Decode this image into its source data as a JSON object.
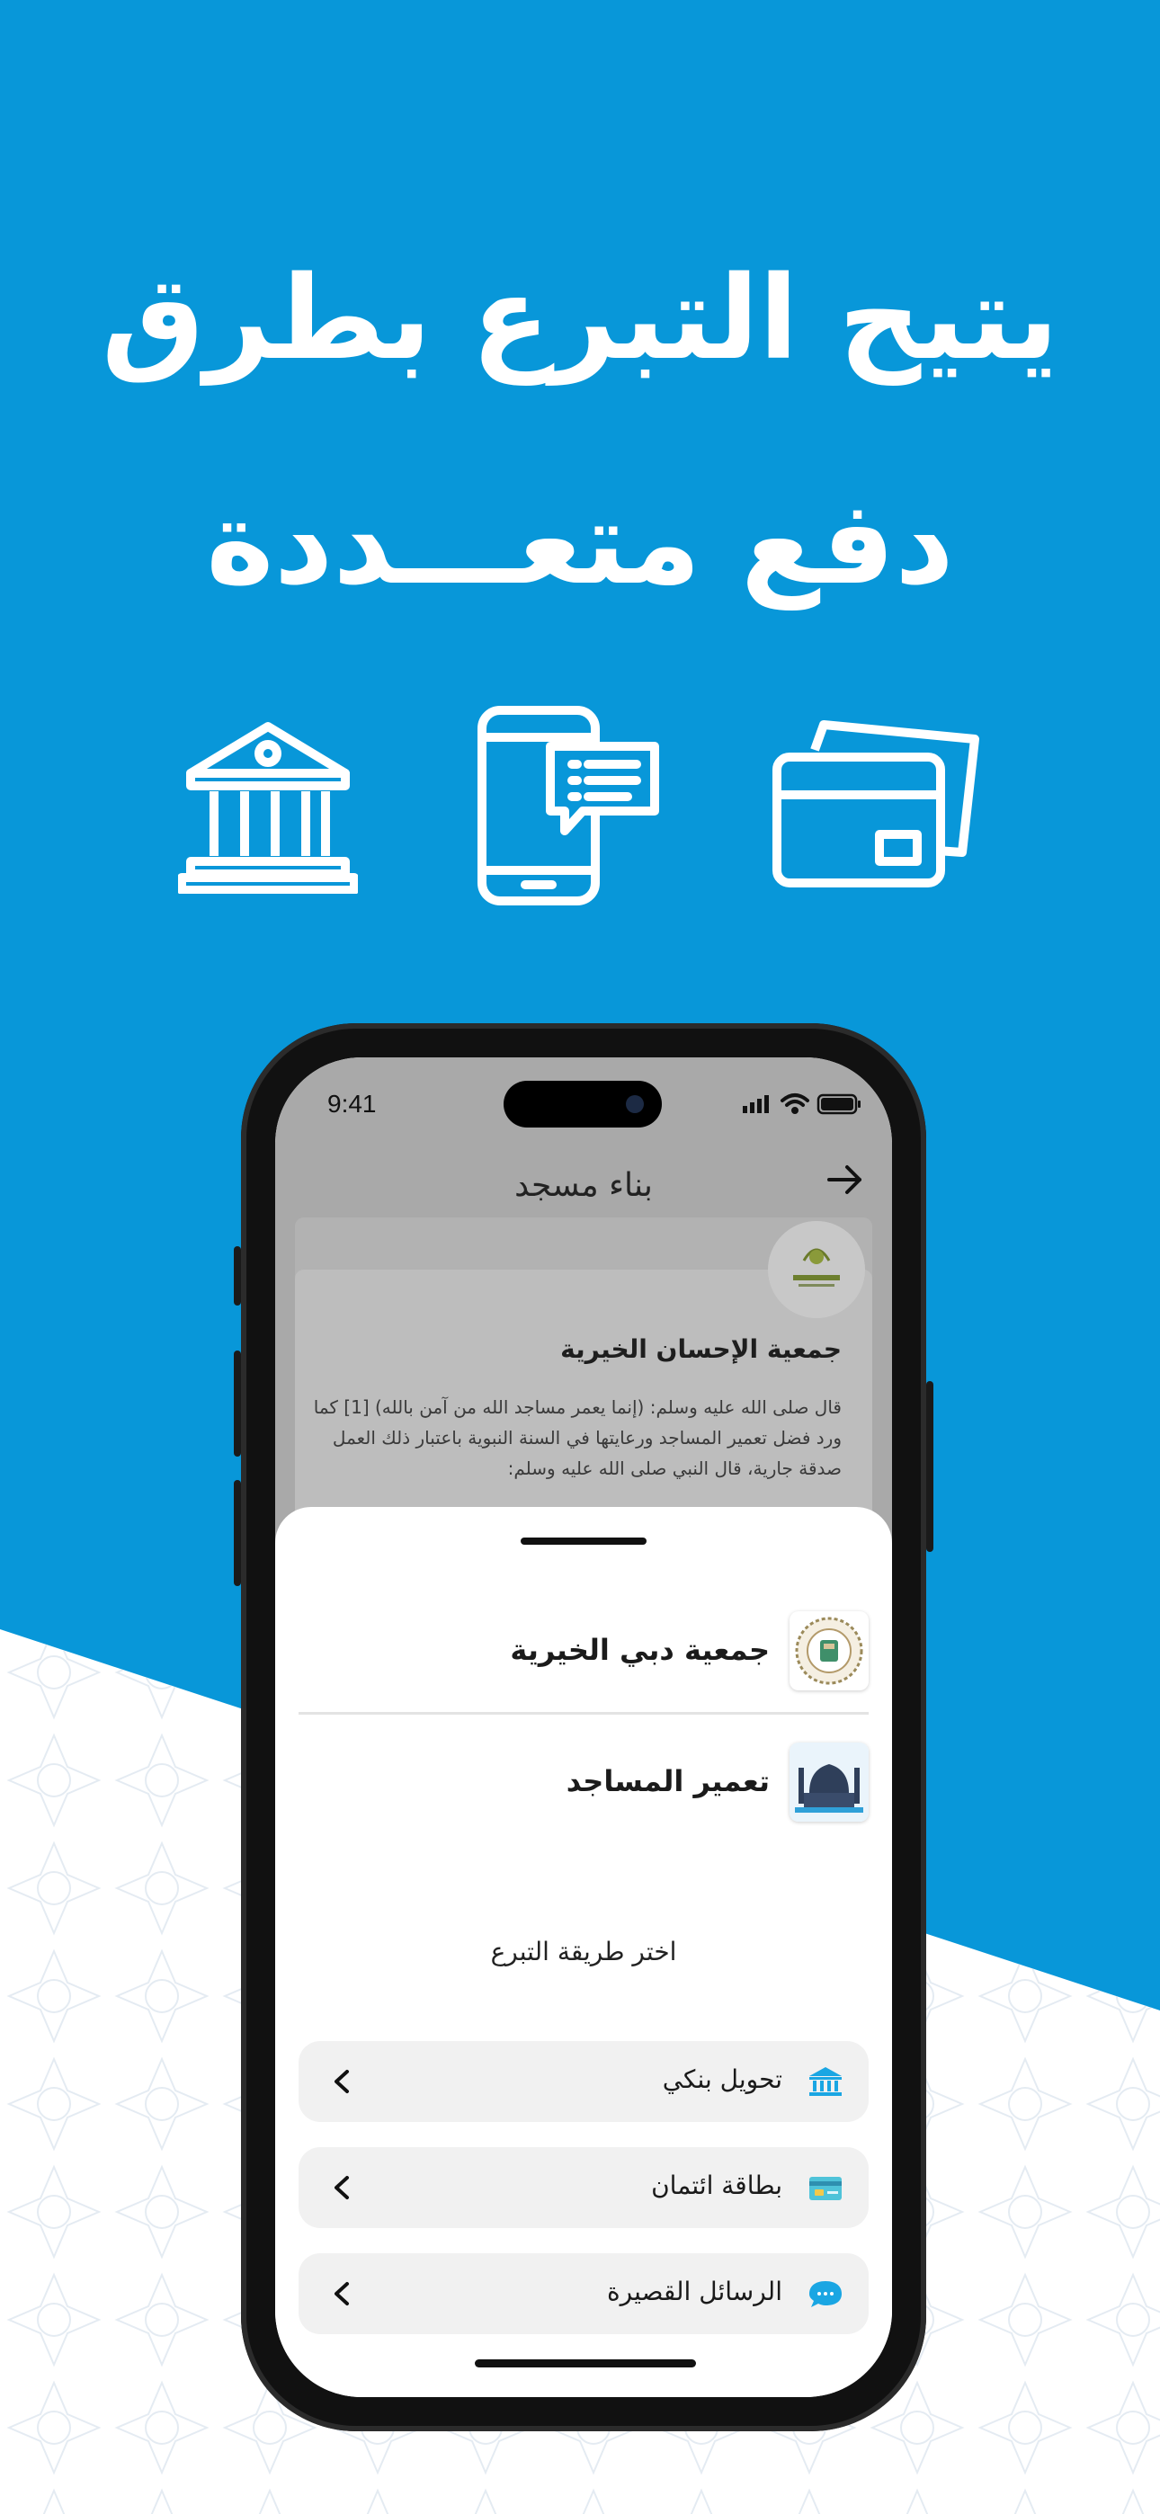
{
  "promo": {
    "headline_line1": "يتيح التبرع بطرق",
    "headline_line2": "دفع متعـــددة",
    "feature_icons": [
      "bank-icon",
      "sms-phone-icon",
      "credit-card-icon"
    ]
  },
  "colors": {
    "background_blue": "#0897d9",
    "accent": "#1aa6e3",
    "white": "#ffffff"
  },
  "status_bar": {
    "time": "9:41"
  },
  "screen": {
    "nav_title": "بناء مسجد",
    "org_name": "جمعية الإحسان الخيرية",
    "org_description": "قال صلى الله عليه وسلم: (إنما يعمر مساجد الله من آمن بالله) [1] كما ورد فضل تعمير المساجد ورعايتها في السنة النبوية باعتبار ذلك العمل صدقة جارية، قال النبي صلى الله عليه وسلم:"
  },
  "sheet": {
    "entities": [
      {
        "label": "جمعية دبي الخيرية",
        "icon": "charity-logo-icon"
      },
      {
        "label": "تعمير المساجد",
        "icon": "mosque-icon"
      }
    ],
    "choose_label": "اختر طريقة التبرع",
    "methods": [
      {
        "label": "تحويل بنكي",
        "icon": "bank-icon"
      },
      {
        "label": "بطاقة ائتمان",
        "icon": "credit-card-icon"
      },
      {
        "label": "الرسائل القصيرة",
        "icon": "sms-bubble-icon"
      }
    ]
  }
}
